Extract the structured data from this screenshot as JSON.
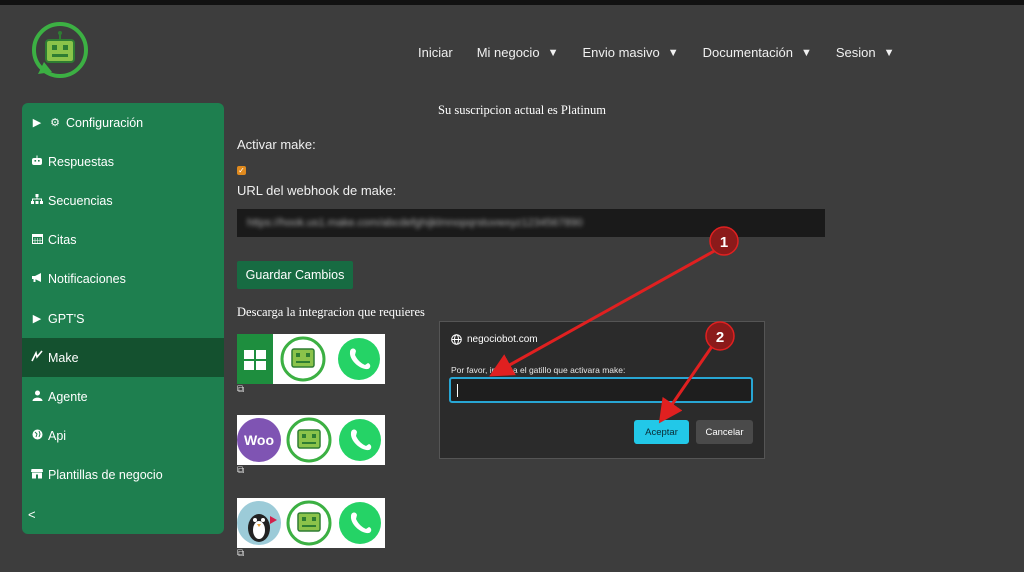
{
  "nav": {
    "items": [
      {
        "label": "Iniciar",
        "dropdown": false
      },
      {
        "label": "Mi negocio",
        "dropdown": true
      },
      {
        "label": "Envio masivo",
        "dropdown": true
      },
      {
        "label": "Documentación",
        "dropdown": true
      },
      {
        "label": "Sesion",
        "dropdown": true
      }
    ],
    "caret": "▼"
  },
  "sidebar": {
    "items": [
      {
        "label": "Configuración",
        "icon": "gear-icon",
        "glyph": "⚙",
        "prefix": "▶"
      },
      {
        "label": "Respuestas",
        "icon": "robot-icon",
        "glyph": "🤖"
      },
      {
        "label": "Secuencias",
        "icon": "sitemap-icon",
        "glyph": "⧉"
      },
      {
        "label": "Citas",
        "icon": "calendar-icon",
        "glyph": "▦"
      },
      {
        "label": "Notificaciones",
        "icon": "bullhorn-icon",
        "glyph": "📢"
      },
      {
        "label": "GPT'S",
        "icon": "triangle-icon",
        "glyph": "▶"
      },
      {
        "label": "Make",
        "icon": "make-icon",
        "glyph": "↗",
        "active": true
      },
      {
        "label": "Agente",
        "icon": "user-icon",
        "glyph": "👤"
      },
      {
        "label": "Api",
        "icon": "globe-icon",
        "glyph": "◉"
      },
      {
        "label": "Plantillas de negocio",
        "icon": "store-icon",
        "glyph": "▤"
      }
    ],
    "collapse_label": "<"
  },
  "main": {
    "subscription_text": "Su suscripcion actual es Platinum",
    "activate_label": "Activar make:",
    "activate_checked": true,
    "webhook_label": "URL del webhook de make:",
    "webhook_value": "https://hook.us1.make.com/abcdefghijklmnopqrstuvwxyz1234567890",
    "save_button": "Guardar Cambios",
    "download_title": "Descarga la integracion que requieres"
  },
  "integrations": [
    {
      "name": "google-sheets",
      "label": "⊞"
    },
    {
      "name": "woocommerce",
      "label": "Woo"
    },
    {
      "name": "prestashop",
      "label": ""
    }
  ],
  "dialog": {
    "site": "negociobot.com",
    "message": "Por favor, ingresa el gatillo que activara make:",
    "input_value": "",
    "ok_label": "Aceptar",
    "cancel_label": "Cancelar"
  },
  "annotations": {
    "markers": [
      "1",
      "2"
    ],
    "color": "#e02020"
  },
  "colors": {
    "brand_green": "#1e7f4f",
    "active_green": "#14512f",
    "accent_cyan": "#22c8e8",
    "checkbox_orange": "#e08a1e"
  }
}
